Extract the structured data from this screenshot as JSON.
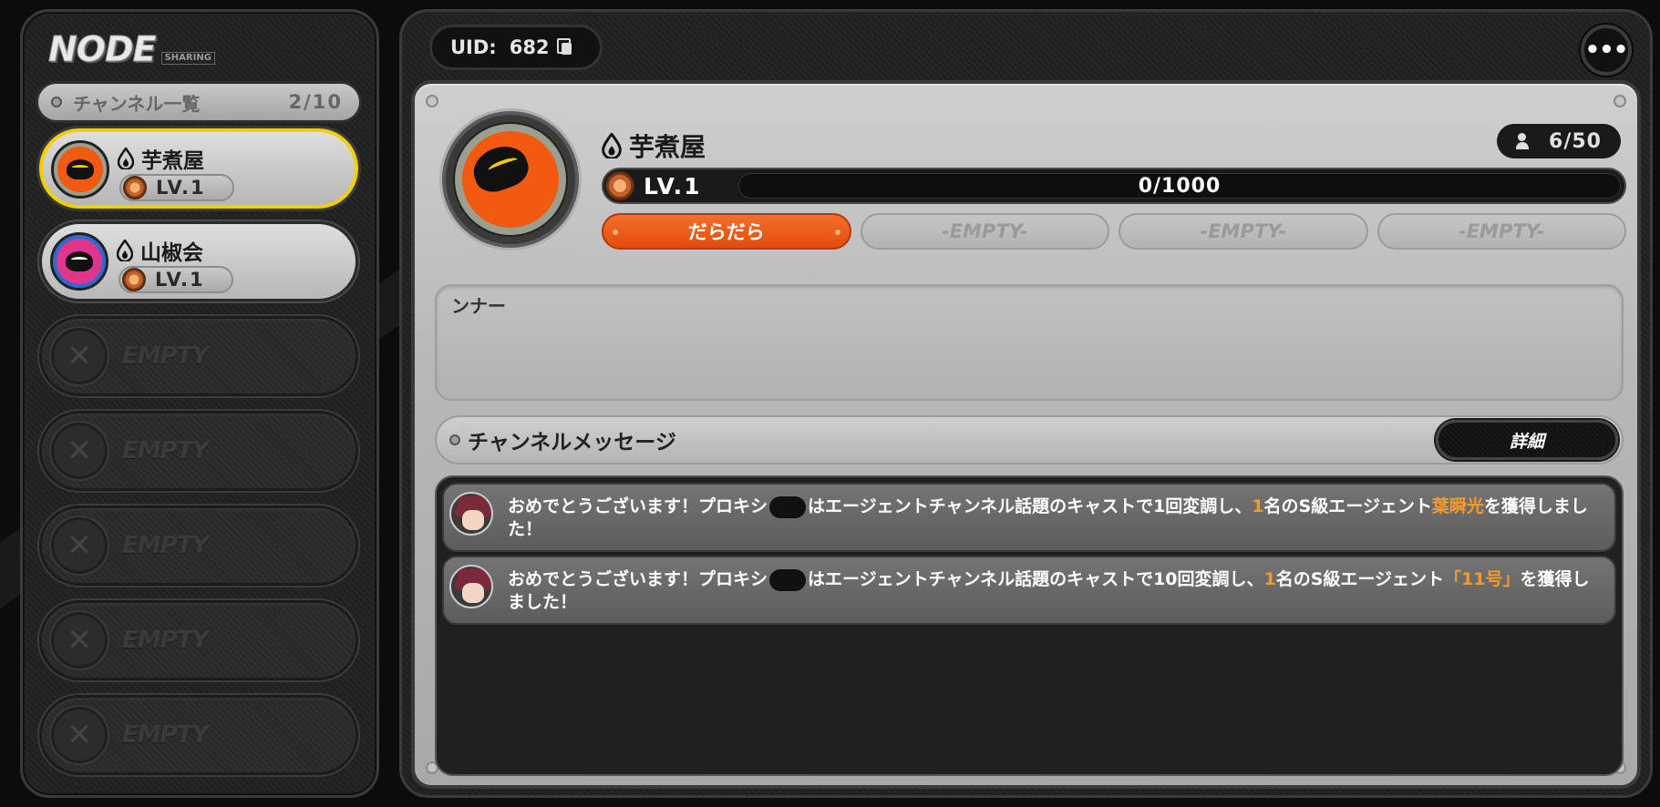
{
  "logo": {
    "main": "NODE",
    "sub": "SHARING"
  },
  "sidebar": {
    "header_title": "チャンネル一覧",
    "count": "2/10",
    "channels": [
      {
        "name": "芋煮屋",
        "level": "LV.1",
        "avatar": "orange-bird-icon",
        "selected": true
      },
      {
        "name": "山椒会",
        "level": "LV.1",
        "avatar": "pink-bird-icon",
        "selected": false
      }
    ],
    "empty_slots": [
      "EMPTY",
      "EMPTY",
      "EMPTY",
      "EMPTY",
      "EMPTY"
    ]
  },
  "topbar": {
    "uid_label": "UID:",
    "uid_value": "682",
    "menu_label": "•••"
  },
  "channel": {
    "name": "芋煮屋",
    "members": "6/50",
    "level": "LV.1",
    "xp_text": "0/1000",
    "xp_fraction": 0,
    "tags": [
      "だらだら",
      "-EMPTY-",
      "-EMPTY-",
      "-EMPTY-"
    ],
    "banner": "ンナー"
  },
  "messages": {
    "title": "チャンネルメッセージ",
    "detail_button": "詳細",
    "items": [
      {
        "prefix": "おめでとうございます！プロキシ",
        "middle": "はエージェントチャンネル話題のキャストで1回変調し、",
        "count": "1",
        "after_count": "名のS級エージェント",
        "agent": "葉瞬光",
        "suffix": "を獲得しました！"
      },
      {
        "prefix": "おめでとうございます！プロキシ",
        "middle": "はエージェントチャンネル話題のキャストで10回変調し、",
        "count": "1",
        "after_count": "名のS級エージェント",
        "agent": "「11号」",
        "suffix": "を獲得しました！"
      }
    ]
  },
  "colors": {
    "accent": "#f15a10",
    "highlight": "#f59a2c",
    "selected_border": "#f2d000"
  }
}
